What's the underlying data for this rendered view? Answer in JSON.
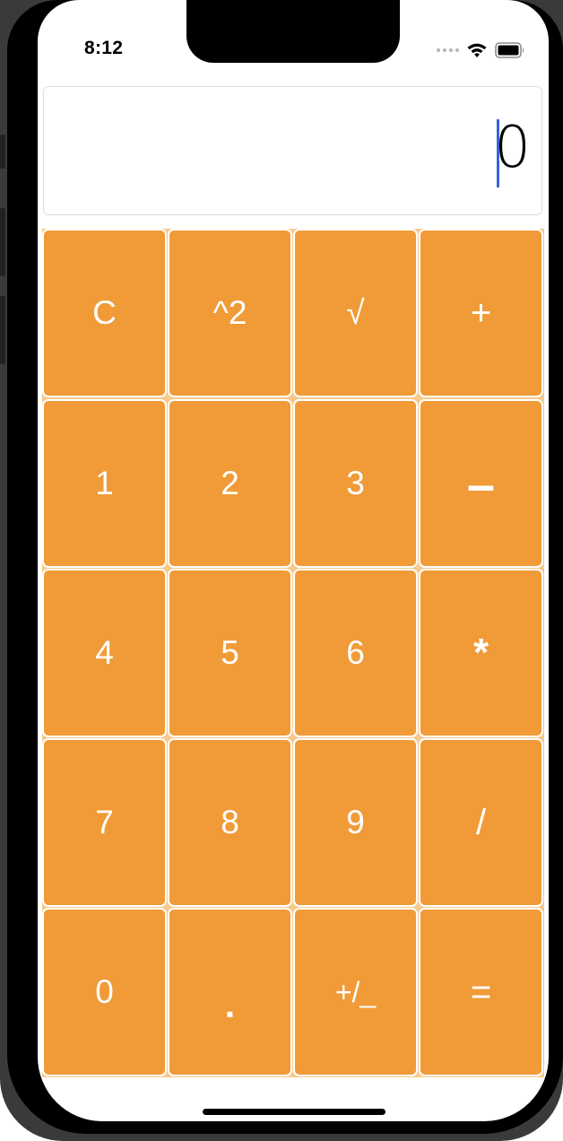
{
  "status_bar": {
    "time": "8:12"
  },
  "display": {
    "value": "0"
  },
  "keypad": {
    "rows": [
      [
        {
          "label": "C",
          "name": "clear-button"
        },
        {
          "label": "^2",
          "name": "square-button"
        },
        {
          "label": "√",
          "name": "sqrt-button"
        },
        {
          "label": "+",
          "name": "plus-button"
        }
      ],
      [
        {
          "label": "1",
          "name": "digit-1-button"
        },
        {
          "label": "2",
          "name": "digit-2-button"
        },
        {
          "label": "3",
          "name": "digit-3-button"
        },
        {
          "label": "–",
          "name": "minus-button"
        }
      ],
      [
        {
          "label": "4",
          "name": "digit-4-button"
        },
        {
          "label": "5",
          "name": "digit-5-button"
        },
        {
          "label": "6",
          "name": "digit-6-button"
        },
        {
          "label": "*",
          "name": "multiply-button"
        }
      ],
      [
        {
          "label": "7",
          "name": "digit-7-button"
        },
        {
          "label": "8",
          "name": "digit-8-button"
        },
        {
          "label": "9",
          "name": "digit-9-button"
        },
        {
          "label": "/",
          "name": "divide-button"
        }
      ],
      [
        {
          "label": "0",
          "name": "digit-0-button"
        },
        {
          "label": ".",
          "name": "decimal-button"
        },
        {
          "label": "+/_",
          "name": "sign-toggle-button"
        },
        {
          "label": "=",
          "name": "equals-button"
        }
      ]
    ]
  },
  "colors": {
    "key_background": "#f09b38",
    "key_text": "#ffffff",
    "caret": "#3366dd"
  },
  "icons": {
    "status": [
      "cellular-dots-icon",
      "wifi-icon",
      "battery-icon"
    ]
  }
}
